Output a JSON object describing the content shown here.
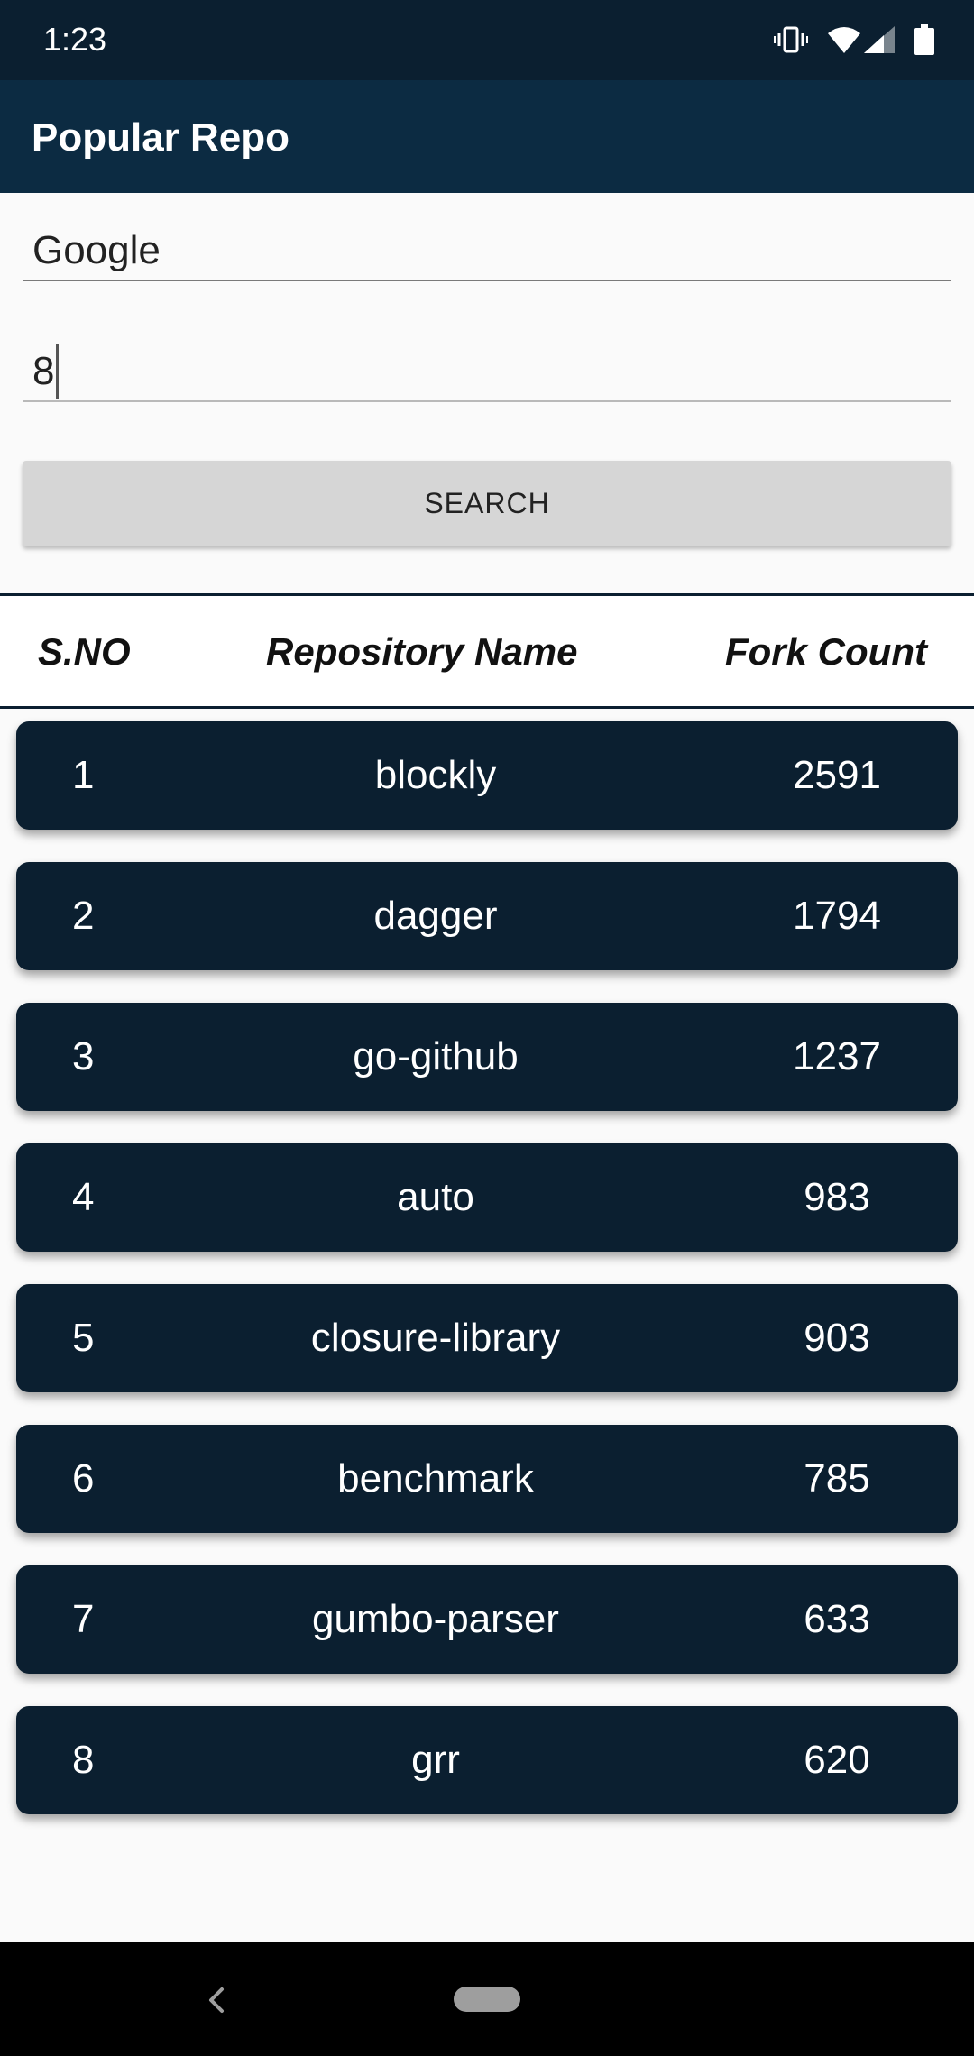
{
  "status_bar": {
    "time": "1:23",
    "icons": [
      "vibrate-icon",
      "wifi-icon",
      "signal-icon",
      "battery-icon"
    ]
  },
  "app_bar": {
    "title": "Popular Repo"
  },
  "search_form": {
    "query_value": "Google",
    "count_value": "8",
    "search_label": "SEARCH"
  },
  "table": {
    "headers": [
      "S.NO",
      "Repository Name",
      "Fork Count"
    ],
    "rows": [
      {
        "sno": "1",
        "name": "blockly",
        "forks": "2591"
      },
      {
        "sno": "2",
        "name": "dagger",
        "forks": "1794"
      },
      {
        "sno": "3",
        "name": "go-github",
        "forks": "1237"
      },
      {
        "sno": "4",
        "name": "auto",
        "forks": "983"
      },
      {
        "sno": "5",
        "name": "closure-library",
        "forks": "903"
      },
      {
        "sno": "6",
        "name": "benchmark",
        "forks": "785"
      },
      {
        "sno": "7",
        "name": "gumbo-parser",
        "forks": "633"
      },
      {
        "sno": "8",
        "name": "grr",
        "forks": "620"
      }
    ]
  },
  "nav_bar": {
    "icons": [
      "back-icon",
      "home-pill-icon"
    ]
  },
  "colors": {
    "status_bar": "#0b1f30",
    "app_bar": "#0c2b42",
    "card": "#0b1f30",
    "button": "#d6d6d6",
    "background": "#fafafa"
  }
}
